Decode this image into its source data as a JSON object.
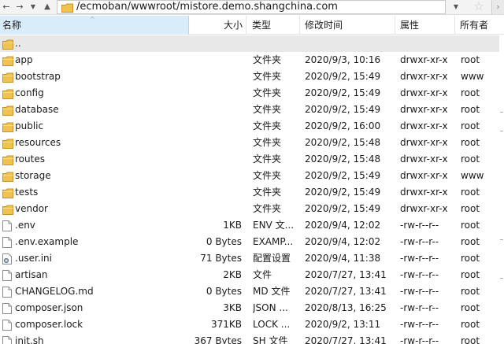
{
  "toolbar": {
    "back": "←",
    "forward": "→",
    "dropdown": "▼",
    "up": "▲",
    "path": "/ecmoban/wwwroot/mistore.demo.shangchina.com",
    "path_dropdown": "▼",
    "bookmark": "☆",
    "edge": "›"
  },
  "columns": {
    "name": "名称",
    "size": "大小",
    "type": "类型",
    "mtime": "修改时间",
    "perm": "属性",
    "owner": "所有者"
  },
  "colors": {
    "folder": "#e8b53a",
    "folder_dark": "#c9922a",
    "header_active": "#d9ecfa",
    "parent_row": "#e8e8e8"
  },
  "rows": [
    {
      "kind": "folder",
      "icon": "folder-icon",
      "name": "..",
      "size": "",
      "type": "",
      "mtime": "",
      "perm": "",
      "owner": ""
    },
    {
      "kind": "folder",
      "icon": "folder-icon",
      "name": "app",
      "size": "",
      "type": "文件夹",
      "mtime": "2020/9/3, 10:16",
      "perm": "drwxr-xr-x",
      "owner": "root"
    },
    {
      "kind": "folder",
      "icon": "folder-icon",
      "name": "bootstrap",
      "size": "",
      "type": "文件夹",
      "mtime": "2020/9/2, 15:49",
      "perm": "drwxr-xr-x",
      "owner": "www"
    },
    {
      "kind": "folder",
      "icon": "folder-icon",
      "name": "config",
      "size": "",
      "type": "文件夹",
      "mtime": "2020/9/2, 15:49",
      "perm": "drwxr-xr-x",
      "owner": "root"
    },
    {
      "kind": "folder",
      "icon": "folder-icon",
      "name": "database",
      "size": "",
      "type": "文件夹",
      "mtime": "2020/9/2, 15:49",
      "perm": "drwxr-xr-x",
      "owner": "root"
    },
    {
      "kind": "folder",
      "icon": "folder-icon",
      "name": "public",
      "size": "",
      "type": "文件夹",
      "mtime": "2020/9/2, 16:00",
      "perm": "drwxr-xr-x",
      "owner": "root"
    },
    {
      "kind": "folder",
      "icon": "folder-icon",
      "name": "resources",
      "size": "",
      "type": "文件夹",
      "mtime": "2020/9/2, 15:48",
      "perm": "drwxr-xr-x",
      "owner": "root"
    },
    {
      "kind": "folder",
      "icon": "folder-icon",
      "name": "routes",
      "size": "",
      "type": "文件夹",
      "mtime": "2020/9/2, 15:48",
      "perm": "drwxr-xr-x",
      "owner": "root"
    },
    {
      "kind": "folder",
      "icon": "folder-icon",
      "name": "storage",
      "size": "",
      "type": "文件夹",
      "mtime": "2020/9/2, 15:49",
      "perm": "drwxr-xr-x",
      "owner": "www"
    },
    {
      "kind": "folder",
      "icon": "folder-icon",
      "name": "tests",
      "size": "",
      "type": "文件夹",
      "mtime": "2020/9/2, 15:49",
      "perm": "drwxr-xr-x",
      "owner": "root"
    },
    {
      "kind": "folder",
      "icon": "folder-icon",
      "name": "vendor",
      "size": "",
      "type": "文件夹",
      "mtime": "2020/9/2, 15:49",
      "perm": "drwxr-xr-x",
      "owner": "root"
    },
    {
      "kind": "file",
      "icon": "file-icon",
      "name": ".env",
      "size": "1KB",
      "type": "ENV 文...",
      "mtime": "2020/9/4, 12:02",
      "perm": "-rw-r--r--",
      "owner": "root"
    },
    {
      "kind": "file",
      "icon": "file-icon",
      "name": ".env.example",
      "size": "0 Bytes",
      "type": "EXAMP...",
      "mtime": "2020/9/4, 12:02",
      "perm": "-rw-r--r--",
      "owner": "root"
    },
    {
      "kind": "settings",
      "icon": "settings-file-icon",
      "name": ".user.ini",
      "size": "71 Bytes",
      "type": "配置设置",
      "mtime": "2020/9/4, 11:38",
      "perm": "-rw-r--r--",
      "owner": "root"
    },
    {
      "kind": "file",
      "icon": "file-icon",
      "name": "artisan",
      "size": "2KB",
      "type": "文件",
      "mtime": "2020/7/27, 13:41",
      "perm": "-rw-r--r--",
      "owner": "root"
    },
    {
      "kind": "file",
      "icon": "file-icon",
      "name": "CHANGELOG.md",
      "size": "0 Bytes",
      "type": "MD 文件",
      "mtime": "2020/7/27, 13:41",
      "perm": "-rw-r--r--",
      "owner": "root"
    },
    {
      "kind": "file",
      "icon": "file-icon",
      "name": "composer.json",
      "size": "3KB",
      "type": "JSON ...",
      "mtime": "2020/8/13, 16:25",
      "perm": "-rw-r--r--",
      "owner": "root"
    },
    {
      "kind": "file",
      "icon": "file-icon",
      "name": "composer.lock",
      "size": "371KB",
      "type": "LOCK ...",
      "mtime": "2020/9/2, 13:11",
      "perm": "-rw-r--r--",
      "owner": "root"
    },
    {
      "kind": "file",
      "icon": "file-icon",
      "name": "init.sh",
      "size": "367 Bytes",
      "type": "SH 文件",
      "mtime": "2020/7/27, 13:41",
      "perm": "-rw-r--r--",
      "owner": "root"
    }
  ]
}
